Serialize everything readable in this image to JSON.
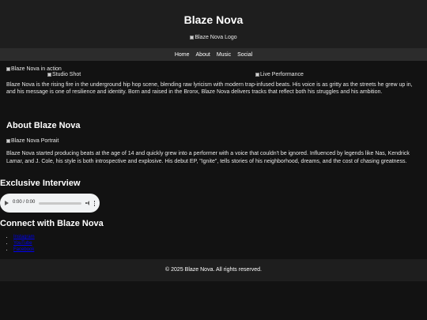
{
  "header": {
    "title": "Blaze Nova",
    "logo_alt": "Blaze Nova Logo"
  },
  "nav": {
    "items": [
      "Home",
      "About",
      "Music",
      "Social"
    ]
  },
  "intro": {
    "img_action_alt": "Blaze Nova in action",
    "img_studio_alt": "Studio Shot",
    "img_live_alt": "Live Performance",
    "text": "Blaze Nova is the rising fire in the underground hip hop scene, blending raw lyricism with modern trap-infused beats. His voice is as gritty as the streets he grew up in, and his message is one of resilience and identity. Born and raised in the Bronx, Blaze Nova delivers tracks that reflect both his struggles and his ambition."
  },
  "about": {
    "heading": "About Blaze Nova",
    "portrait_alt": "Blaze Nova Portrait",
    "text": "Blaze Nova started producing beats at the age of 14 and quickly grew into a performer with a voice that couldn't be ignored. Influenced by legends like Nas, Kendrick Lamar, and J. Cole, his style is both introspective and explosive. His debut EP, \"Ignite\", tells stories of his neighborhood, dreams, and the cost of chasing greatness."
  },
  "interview": {
    "heading": "Exclusive Interview",
    "time": "0:00 / 0:00"
  },
  "connect": {
    "heading": "Connect with Blaze Nova",
    "links": [
      "Instagram",
      "YouTube",
      "Facebook"
    ]
  },
  "footer": {
    "text": "© 2025 Blaze Nova. All rights reserved."
  }
}
